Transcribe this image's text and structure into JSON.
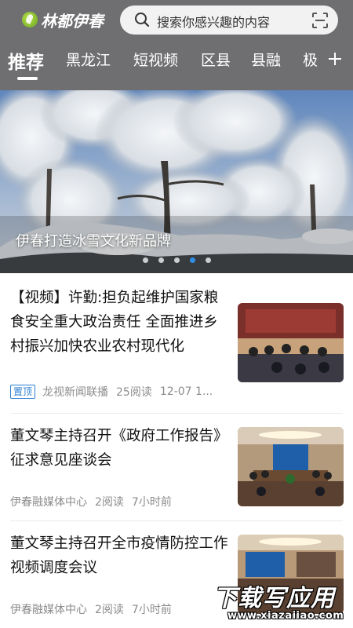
{
  "header": {
    "logo_text": "林都伊春",
    "search_placeholder": "搜索你感兴趣的内容"
  },
  "tabs": [
    {
      "label": "推荐",
      "active": true
    },
    {
      "label": "黑龙江",
      "active": false
    },
    {
      "label": "短视频",
      "active": false
    },
    {
      "label": "区县",
      "active": false
    },
    {
      "label": "县融",
      "active": false
    },
    {
      "label": "极",
      "active": false
    }
  ],
  "banner": {
    "title": "伊春打造冰雪文化新品牌",
    "slide_count": 5,
    "active_slide": 4
  },
  "news": [
    {
      "title": "【视频】许勤:担负起维护国家粮食安全重大政治责任 全面推进乡村振兴加快农业农村现代化",
      "badge": "置顶",
      "source": "龙视新闻联播",
      "reads": "25阅读",
      "time": "12-07 1..."
    },
    {
      "title": "董文琴主持召开《政府工作报告》征求意见座谈会",
      "source": "伊春融媒体中心",
      "reads": "2阅读",
      "time": "7小时前"
    },
    {
      "title": "董文琴主持召开全市疫情防控工作视频调度会议",
      "source": "伊春融媒体中心",
      "reads": "2阅读",
      "time": "7小时前"
    }
  ],
  "watermark": {
    "main": "下载写应用",
    "sub": "www.xiazaiiao.com"
  },
  "colors": {
    "header_bg": "#6f6f72",
    "accent_blue": "#2a7fd4",
    "dot_active": "#2f8fe6",
    "meta_gray": "#8c8c8c"
  }
}
